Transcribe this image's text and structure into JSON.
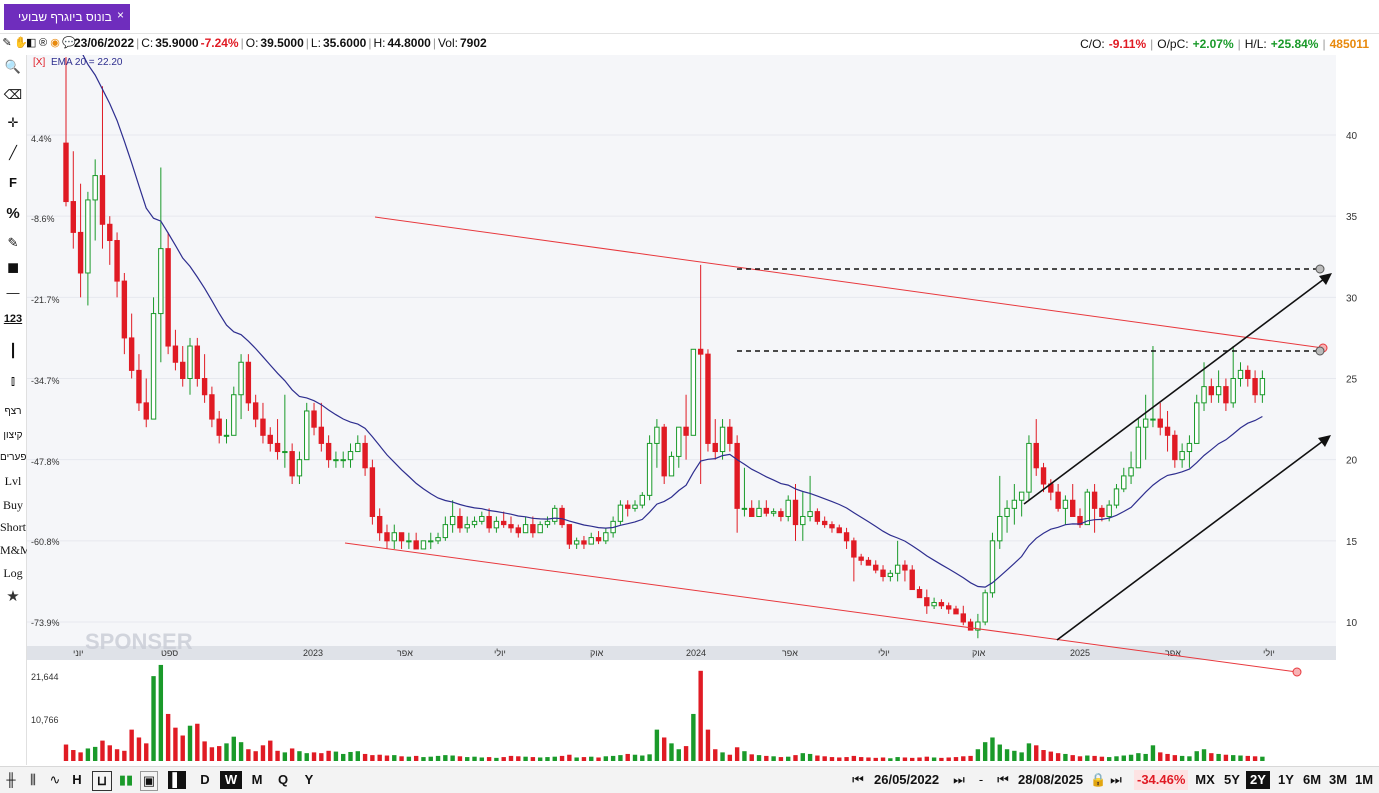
{
  "window": {
    "tab_label": "בונוס ביוגרף שבועי",
    "close_glyph": "×"
  },
  "infobar": {
    "icons": [
      "pencil-chart-icon",
      "hand-icon",
      "share-icon",
      "trademark-icon",
      "target-icon",
      "chat-icon"
    ],
    "date": "23/06/2022",
    "close_label": "C:",
    "close_value": "35.9000",
    "close_change": "-7.24%",
    "open_label": "O:",
    "open_value": "39.5000",
    "low_label": "L:",
    "low_value": "35.6000",
    "high_label": "H:",
    "high_value": "44.8000",
    "vol_label": "Vol:",
    "vol_value": "7902",
    "co_label": "C/O:",
    "co_value": "-9.11%",
    "opc_label": "O/pC:",
    "opc_value": "+2.07%",
    "hl_label": "H/L:",
    "hl_value": "+25.84%",
    "security_id": "485011"
  },
  "indicator": {
    "remove_label": "[X]",
    "text": "EMA 20 = 22.20"
  },
  "sidebar": {
    "tools": [
      {
        "name": "search-icon",
        "glyph": "🔍"
      },
      {
        "name": "eraser-icon",
        "glyph": "⌫"
      },
      {
        "name": "crosshair-icon",
        "glyph": "✛"
      },
      {
        "name": "line-tool-icon",
        "glyph": "╱"
      },
      {
        "name": "fibonacci-icon",
        "glyph": "F"
      },
      {
        "name": "percent-icon",
        "glyph": "%"
      },
      {
        "name": "edit-icon",
        "glyph": "✎"
      },
      {
        "name": "color-box-icon",
        "glyph": "■"
      },
      {
        "name": "horizontal-line-icon",
        "glyph": "—"
      },
      {
        "name": "number-icon",
        "glyph": "123"
      },
      {
        "name": "vertical-line-icon",
        "glyph": "┃"
      },
      {
        "name": "candles-icon",
        "glyph": "⫾"
      }
    ],
    "text_items": [
      "רצף",
      "קיצון",
      "פערים",
      "Lvl",
      "Buy",
      "Short",
      "M&M",
      "Log"
    ],
    "star_glyph": "★"
  },
  "colors": {
    "up": "#1a9a2a",
    "down": "#e01b24",
    "ema": "#2e2e8f",
    "channel": "#e8383d",
    "trend": "#111111",
    "accent": "#6f2dbd"
  },
  "watermark": "SPONSER",
  "chart_data": {
    "type": "candlestick",
    "timeframe": "weekly",
    "indicator": {
      "name": "EMA 20",
      "last": 22.2
    },
    "price_axis": {
      "ticks": [
        10,
        15,
        20,
        25,
        30,
        35,
        40
      ],
      "ylim": [
        8,
        43
      ]
    },
    "percent_axis": {
      "ticks": [
        "4.4%",
        "-8.6%",
        "-21.7%",
        "-34.7%",
        "-47.8%",
        "-60.8%",
        "-73.9%"
      ]
    },
    "x_tick_labels": [
      "יוני",
      "ספט",
      "2023",
      "אפר",
      "יולי",
      "אוק",
      "2024",
      "אפר",
      "יולי",
      "אוק",
      "2025",
      "אפר",
      "יולי"
    ],
    "volume_axis": {
      "ticks": [
        "21,644",
        "10,766"
      ]
    },
    "bars": [
      [
        39.5,
        44.8,
        35.6,
        35.9
      ],
      [
        35.9,
        39.0,
        33.0,
        34.0
      ],
      [
        34.0,
        37.0,
        30.0,
        31.5
      ],
      [
        31.5,
        36.5,
        29.5,
        36.0
      ],
      [
        36.0,
        38.5,
        33.5,
        37.5
      ],
      [
        37.5,
        43.0,
        33.0,
        34.5
      ],
      [
        34.5,
        35.0,
        32.0,
        33.5
      ],
      [
        33.5,
        34.0,
        30.0,
        31.0
      ],
      [
        31.0,
        31.5,
        26.5,
        27.5
      ],
      [
        27.5,
        29.0,
        25.0,
        25.5
      ],
      [
        25.5,
        26.5,
        23.0,
        23.5
      ],
      [
        23.5,
        25.0,
        22.0,
        22.5
      ],
      [
        22.5,
        30.0,
        22.5,
        29.0
      ],
      [
        29.0,
        38.0,
        26.0,
        33.0
      ],
      [
        33.0,
        34.0,
        26.5,
        27.0
      ],
      [
        27.0,
        28.0,
        25.5,
        26.0
      ],
      [
        26.0,
        27.0,
        24.5,
        25.0
      ],
      [
        25.0,
        27.5,
        24.0,
        27.0
      ],
      [
        27.0,
        27.5,
        24.5,
        25.0
      ],
      [
        25.0,
        26.5,
        23.5,
        24.0
      ],
      [
        24.0,
        24.5,
        22.0,
        22.5
      ],
      [
        22.5,
        23.0,
        21.0,
        21.5
      ],
      [
        21.5,
        22.5,
        21.0,
        21.5
      ],
      [
        21.5,
        24.5,
        21.5,
        24.0
      ],
      [
        24.0,
        26.5,
        22.5,
        26.0
      ],
      [
        26.0,
        26.5,
        23.0,
        23.5
      ],
      [
        23.5,
        24.0,
        22.0,
        22.5
      ],
      [
        22.5,
        23.5,
        21.0,
        21.5
      ],
      [
        21.5,
        22.0,
        20.5,
        21.0
      ],
      [
        21.0,
        22.5,
        20.0,
        20.5
      ],
      [
        20.5,
        24.0,
        19.5,
        20.5
      ],
      [
        20.5,
        21.0,
        18.5,
        19.0
      ],
      [
        19.0,
        20.5,
        18.5,
        20.0
      ],
      [
        20.0,
        23.5,
        20.0,
        23.0
      ],
      [
        23.0,
        23.5,
        21.5,
        22.0
      ],
      [
        22.0,
        23.5,
        20.5,
        21.0
      ],
      [
        21.0,
        21.5,
        19.5,
        20.0
      ],
      [
        20.0,
        20.5,
        19.5,
        20.0
      ],
      [
        20.0,
        20.5,
        19.5,
        20.0
      ],
      [
        20.0,
        21.0,
        19.5,
        20.5
      ],
      [
        20.5,
        21.5,
        20.5,
        21.0
      ],
      [
        21.0,
        21.5,
        19.0,
        19.5
      ],
      [
        19.5,
        20.0,
        16.0,
        16.5
      ],
      [
        16.5,
        17.0,
        15.0,
        15.5
      ],
      [
        15.5,
        16.0,
        14.5,
        15.0
      ],
      [
        15.0,
        16.0,
        14.5,
        15.5
      ],
      [
        15.5,
        15.5,
        14.5,
        15.0
      ],
      [
        15.0,
        15.5,
        14.5,
        15.0
      ],
      [
        15.0,
        15.5,
        14.5,
        14.5
      ],
      [
        14.5,
        15.0,
        14.5,
        15.0
      ],
      [
        15.0,
        15.5,
        14.5,
        15.0
      ],
      [
        15.0,
        15.5,
        14.8,
        15.2
      ],
      [
        15.2,
        16.5,
        15.0,
        16.0
      ],
      [
        16.0,
        17.5,
        15.5,
        16.5
      ],
      [
        16.5,
        17.0,
        15.5,
        15.8
      ],
      [
        15.8,
        16.5,
        15.5,
        16.0
      ],
      [
        16.0,
        16.5,
        15.8,
        16.2
      ],
      [
        16.2,
        16.8,
        16.0,
        16.5
      ],
      [
        16.5,
        17.0,
        15.5,
        15.8
      ],
      [
        15.8,
        16.5,
        15.5,
        16.2
      ],
      [
        16.2,
        16.8,
        15.8,
        16.0
      ],
      [
        16.0,
        16.5,
        15.5,
        15.8
      ],
      [
        15.8,
        16.0,
        15.2,
        15.5
      ],
      [
        15.5,
        16.5,
        15.5,
        16.0
      ],
      [
        16.0,
        16.5,
        15.2,
        15.5
      ],
      [
        15.5,
        16.2,
        15.5,
        16.0
      ],
      [
        16.0,
        16.5,
        15.8,
        16.2
      ],
      [
        16.2,
        17.2,
        16.0,
        17.0
      ],
      [
        17.0,
        17.2,
        15.8,
        16.0
      ],
      [
        16.0,
        16.0,
        14.5,
        14.8
      ],
      [
        14.8,
        15.2,
        14.5,
        15.0
      ],
      [
        15.0,
        15.3,
        14.5,
        14.8
      ],
      [
        14.8,
        15.5,
        14.8,
        15.2
      ],
      [
        15.2,
        15.6,
        14.8,
        15.0
      ],
      [
        15.0,
        15.8,
        14.8,
        15.5
      ],
      [
        15.5,
        16.5,
        15.2,
        16.2
      ],
      [
        16.2,
        17.5,
        16.0,
        17.2
      ],
      [
        17.2,
        17.5,
        16.5,
        17.0
      ],
      [
        17.0,
        17.5,
        16.8,
        17.2
      ],
      [
        17.2,
        18.0,
        17.0,
        17.8
      ],
      [
        17.8,
        21.5,
        17.5,
        21.0
      ],
      [
        21.0,
        22.5,
        19.5,
        22.0
      ],
      [
        22.0,
        22.2,
        18.5,
        19.0
      ],
      [
        19.0,
        20.5,
        19.0,
        20.2
      ],
      [
        20.2,
        22.0,
        19.5,
        22.0
      ],
      [
        22.0,
        24.0,
        20.0,
        21.5
      ],
      [
        21.5,
        26.8,
        21.5,
        26.8
      ],
      [
        26.8,
        32.0,
        18.5,
        26.5
      ],
      [
        26.5,
        26.8,
        20.5,
        21.0
      ],
      [
        21.0,
        22.5,
        20.0,
        20.5
      ],
      [
        20.5,
        22.5,
        20.0,
        22.0
      ],
      [
        22.0,
        22.5,
        20.5,
        21.0
      ],
      [
        21.0,
        21.5,
        15.5,
        17.0
      ],
      [
        17.0,
        19.5,
        16.5,
        17.0
      ],
      [
        17.0,
        17.5,
        16.5,
        16.5
      ],
      [
        16.5,
        17.5,
        16.5,
        17.0
      ],
      [
        17.0,
        17.5,
        16.5,
        16.7
      ],
      [
        16.7,
        17.0,
        16.5,
        16.8
      ],
      [
        16.8,
        17.0,
        16.2,
        16.5
      ],
      [
        16.5,
        17.8,
        16.2,
        17.5
      ],
      [
        17.5,
        18.5,
        15.0,
        16.0
      ],
      [
        16.0,
        18.0,
        15.0,
        16.5
      ],
      [
        16.5,
        19.0,
        16.2,
        16.8
      ],
      [
        16.8,
        17.0,
        16.0,
        16.2
      ],
      [
        16.2,
        16.5,
        15.8,
        16.0
      ],
      [
        16.0,
        16.2,
        15.5,
        15.8
      ],
      [
        15.8,
        16.0,
        15.5,
        15.5
      ],
      [
        15.5,
        15.8,
        14.5,
        15.0
      ],
      [
        15.0,
        15.2,
        12.5,
        14.0
      ],
      [
        14.0,
        14.2,
        13.5,
        13.8
      ],
      [
        13.8,
        14.0,
        13.5,
        13.5
      ],
      [
        13.5,
        13.8,
        13.0,
        13.2
      ],
      [
        13.2,
        13.5,
        12.5,
        12.8
      ],
      [
        12.8,
        13.2,
        12.5,
        13.0
      ],
      [
        13.0,
        15.0,
        12.5,
        13.5
      ],
      [
        13.5,
        13.8,
        12.5,
        13.2
      ],
      [
        13.2,
        13.5,
        12.0,
        12.0
      ],
      [
        12.0,
        12.2,
        11.5,
        11.5
      ],
      [
        11.5,
        12.0,
        10.5,
        11.0
      ],
      [
        11.0,
        11.5,
        10.8,
        11.2
      ],
      [
        11.2,
        11.4,
        10.8,
        11.0
      ],
      [
        11.0,
        11.2,
        10.5,
        10.8
      ],
      [
        10.8,
        11.0,
        10.5,
        10.5
      ],
      [
        10.5,
        11.0,
        9.8,
        10.0
      ],
      [
        10.0,
        10.2,
        9.5,
        9.5
      ],
      [
        9.5,
        10.5,
        9.0,
        10.0
      ],
      [
        10.0,
        12.0,
        9.8,
        11.8
      ],
      [
        11.8,
        15.5,
        11.5,
        15.0
      ],
      [
        15.0,
        19.0,
        14.5,
        16.5
      ],
      [
        16.5,
        17.5,
        15.5,
        17.0
      ],
      [
        17.0,
        18.5,
        16.0,
        17.5
      ],
      [
        17.5,
        18.0,
        16.5,
        18.0
      ],
      [
        18.0,
        21.5,
        17.5,
        21.0
      ],
      [
        21.0,
        22.5,
        19.0,
        19.5
      ],
      [
        19.5,
        19.8,
        18.0,
        18.5
      ],
      [
        18.5,
        18.8,
        17.5,
        18.0
      ],
      [
        18.0,
        18.5,
        16.8,
        17.0
      ],
      [
        17.0,
        17.8,
        16.0,
        17.5
      ],
      [
        17.5,
        18.5,
        16.5,
        16.5
      ],
      [
        16.5,
        17.0,
        15.8,
        16.0
      ],
      [
        16.0,
        18.2,
        16.0,
        18.0
      ],
      [
        18.0,
        18.5,
        15.5,
        17.0
      ],
      [
        17.0,
        17.2,
        16.2,
        16.5
      ],
      [
        16.5,
        17.5,
        16.2,
        17.2
      ],
      [
        17.2,
        18.5,
        17.0,
        18.2
      ],
      [
        18.2,
        19.5,
        18.0,
        19.0
      ],
      [
        19.0,
        20.5,
        18.5,
        19.5
      ],
      [
        19.5,
        22.5,
        19.5,
        22.0
      ],
      [
        22.0,
        24.0,
        20.0,
        22.5
      ],
      [
        22.5,
        27.0,
        22.0,
        22.5
      ],
      [
        22.5,
        23.5,
        21.5,
        22.0
      ],
      [
        22.0,
        23.0,
        20.5,
        21.5
      ],
      [
        21.5,
        21.8,
        19.5,
        20.0
      ],
      [
        20.0,
        21.0,
        19.5,
        20.5
      ],
      [
        20.5,
        21.5,
        19.5,
        21.0
      ],
      [
        21.0,
        24.0,
        21.0,
        23.5
      ],
      [
        23.5,
        26.0,
        23.0,
        24.5
      ],
      [
        24.5,
        25.0,
        23.5,
        24.0
      ],
      [
        24.0,
        25.5,
        23.5,
        24.5
      ],
      [
        24.5,
        25.0,
        23.0,
        23.5
      ],
      [
        23.5,
        27.0,
        23.2,
        25.0
      ],
      [
        25.0,
        26.0,
        24.5,
        25.5
      ],
      [
        25.5,
        25.8,
        24.5,
        25.0
      ],
      [
        25.0,
        25.5,
        23.5,
        24.0
      ],
      [
        24.0,
        25.5,
        23.5,
        25.0
      ]
    ],
    "volumes": [
      4200,
      2800,
      2200,
      3200,
      3600,
      5200,
      4000,
      3000,
      2600,
      8000,
      6000,
      4500,
      21644,
      24500,
      12000,
      8500,
      6500,
      9000,
      9500,
      5000,
      3500,
      3800,
      4500,
      6200,
      4800,
      3000,
      2500,
      4000,
      5200,
      2600,
      2200,
      3200,
      2500,
      2000,
      2200,
      2000,
      2600,
      2400,
      1800,
      2300,
      2500,
      1800,
      1500,
      1600,
      1400,
      1500,
      1200,
      1100,
      1300,
      1000,
      1100,
      1300,
      1500,
      1400,
      1200,
      1000,
      1100,
      900,
      1000,
      800,
      1000,
      1300,
      1200,
      1100,
      1000,
      900,
      1000,
      1100,
      1300,
      1600,
      900,
      1000,
      1100,
      900,
      1200,
      1300,
      1500,
      1800,
      1600,
      1400,
      1700,
      8000,
      6000,
      4500,
      3000,
      3800,
      12000,
      23000,
      8000,
      3000,
      2200,
      1600,
      3500,
      2500,
      1700,
      1500,
      1300,
      1200,
      1000,
      1100,
      1500,
      2000,
      1800,
      1400,
      1200,
      1000,
      900,
      1000,
      1300,
      1000,
      900,
      800,
      900,
      700,
      1000,
      900,
      800,
      900,
      1100,
      900,
      800,
      900,
      1000,
      1200,
      1300,
      3000,
      4800,
      6000,
      4200,
      3000,
      2600,
      2200,
      4500,
      4000,
      2800,
      2400,
      2000,
      1800,
      1500,
      1200,
      1400,
      1300,
      1100,
      1000,
      1200,
      1400,
      1600,
      2000,
      1800,
      4000,
      2200,
      1800,
      1500,
      1300,
      1200,
      2500,
      3000,
      2000,
      1800,
      1600,
      1500,
      1400,
      1300,
      1200,
      1100
    ]
  }
}
